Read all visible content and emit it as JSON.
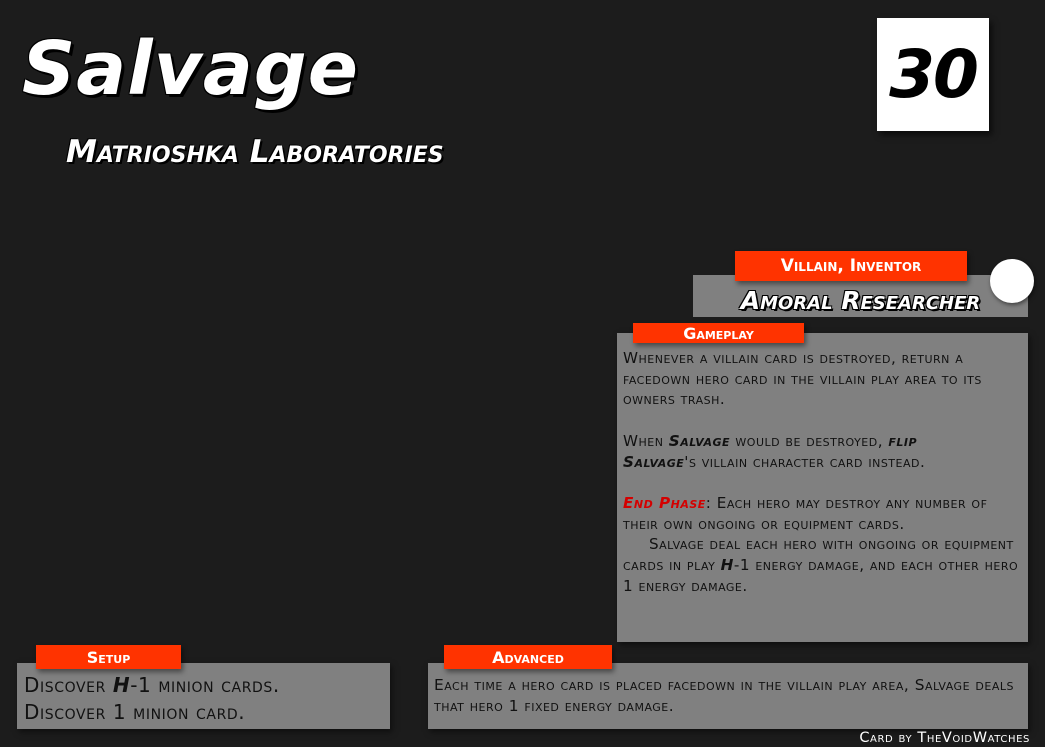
{
  "card": {
    "title": "Salvage",
    "subtitle": "Matrioshka Laboratories",
    "hp": "30"
  },
  "character": {
    "tags": "Villain, Inventor",
    "name": "Amoral Researcher"
  },
  "gameplay": {
    "label": "Gameplay",
    "p1": "Whenever a villain card is destroyed, return a facedown hero card in the villain play area to its owners trash.",
    "p2_pre": "When ",
    "p2_em1": "Salvage",
    "p2_mid": " would be destroyed, ",
    "p2_em2": "flip",
    "p2_br": " ",
    "p2_em3": "Salvage",
    "p2_post": "'s villain character card instead.",
    "p3_phase": "End Phase",
    "p3_text": ": Each hero may destroy any number of their own ongoing or equipment cards.",
    "p4_pre": "Salvage deal each hero with ongoing or equipment cards in play ",
    "p4_em": "H",
    "p4_post": "-1 energy damage, and each other hero 1 energy damage."
  },
  "setup": {
    "label": "Setup",
    "line1_pre": "Discover ",
    "line1_em": "H",
    "line1_post": "-1 minion cards.",
    "line2": "Discover 1 minion card."
  },
  "advanced": {
    "label": "Advanced",
    "text": "Each time a hero card is placed facedown in the villain play area, Salvage deals that hero 1 fixed energy damage."
  },
  "credit": "Card by TheVoidWatches",
  "colors": {
    "background": "#1c1c1c",
    "panel": "#808080",
    "tag": "#ff3300",
    "phase_red": "#d40000"
  }
}
